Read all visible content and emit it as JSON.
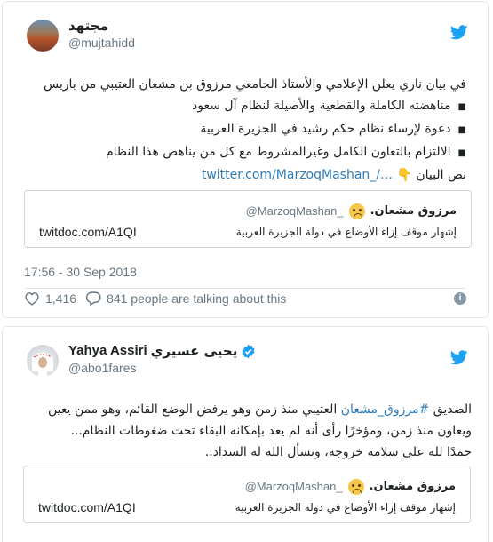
{
  "tweet1": {
    "display_name": "مجتهد",
    "handle": "@mujtahidd",
    "text_lines": [
      "في بيان ناري يعلن الإعلامي والأستاذ الجامعي مرزوق بن مشعان العتيبي من باريس"
    ],
    "bullets": [
      "مناهضته الكاملة والقطعية والأصيلة لنظام آل سعود",
      "دعوة لإرساء نظام حكم رشيد في الجزيرة العربية",
      "الالتزام بالتعاون الكامل وغيرالمشروط مع كل من يناهض هذا النظام"
    ],
    "last_line_prefix": "نص البيان",
    "pointing_emoji": "👇",
    "link": "twitter.com/MarzoqMashan_/…",
    "quote": {
      "name": "مرزوق مشعان.",
      "handle": "@MarzoqMashan_",
      "link": "twitdoc.com/A1QI",
      "description": "إشهار موقف إزاء الأوضاع في دولة الجزيرة العربية"
    },
    "timestamp": "17:56 - 30 Sep 2018",
    "likes": "1,416",
    "talking": "841 people are talking about this"
  },
  "tweet2": {
    "display_name_en": "Yahya Assiri",
    "display_name_ar": "يحيى عسيري",
    "handle": "@abo1fares",
    "text_prefix": "الصديق",
    "hashtag": "#مرزوق_مشعان",
    "text_rest_line1": "العتيبي منذ زمن وهو يرفض الوضع القائم، وهو ممن يعين",
    "text_line2": "ويعاون منذ زمن، ومؤخرًا رأى أنه لم يعد بإمكانه البقاء تحت ضغوطات النظام...",
    "text_line3": "حمدًا لله على سلامة خروجه، ونسأل الله له السداد..",
    "quote": {
      "name": "مرزوق مشعان.",
      "handle": "@MarzoqMashan_",
      "link": "twitdoc.com/A1QI",
      "description": "إشهار موقف إزاء الأوضاع في دولة الجزيرة العربية"
    }
  },
  "colors": {
    "twitter_blue": "#1da1f2",
    "link": "#2b7bb9",
    "muted": "#697882",
    "border": "#e1e8ed"
  },
  "icons": {
    "brand": "twitter-bird-icon",
    "like": "heart-icon",
    "reply": "speech-bubble-icon",
    "info": "info-icon",
    "verified": "verified-badge-icon",
    "emoji": "grimacing-face-emoji"
  }
}
